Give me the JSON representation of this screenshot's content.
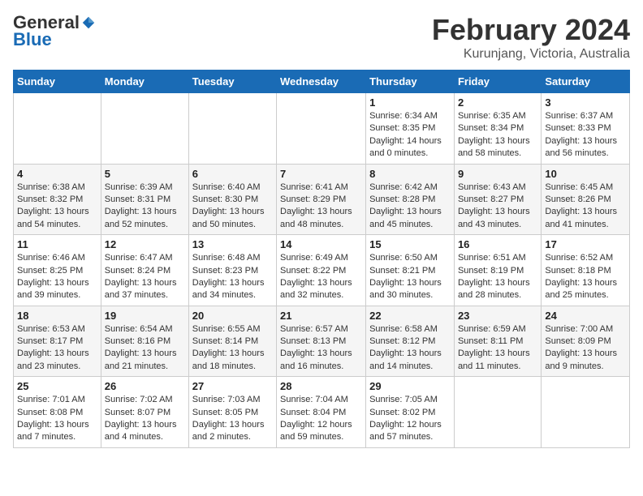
{
  "header": {
    "logo_line1": "General",
    "logo_line2": "Blue",
    "title": "February 2024",
    "subtitle": "Kurunjang, Victoria, Australia"
  },
  "weekdays": [
    "Sunday",
    "Monday",
    "Tuesday",
    "Wednesday",
    "Thursday",
    "Friday",
    "Saturday"
  ],
  "weeks": [
    [
      {
        "num": "",
        "sunrise": "",
        "sunset": "",
        "daylight": ""
      },
      {
        "num": "",
        "sunrise": "",
        "sunset": "",
        "daylight": ""
      },
      {
        "num": "",
        "sunrise": "",
        "sunset": "",
        "daylight": ""
      },
      {
        "num": "",
        "sunrise": "",
        "sunset": "",
        "daylight": ""
      },
      {
        "num": "1",
        "sunrise": "Sunrise: 6:34 AM",
        "sunset": "Sunset: 8:35 PM",
        "daylight": "Daylight: 14 hours and 0 minutes."
      },
      {
        "num": "2",
        "sunrise": "Sunrise: 6:35 AM",
        "sunset": "Sunset: 8:34 PM",
        "daylight": "Daylight: 13 hours and 58 minutes."
      },
      {
        "num": "3",
        "sunrise": "Sunrise: 6:37 AM",
        "sunset": "Sunset: 8:33 PM",
        "daylight": "Daylight: 13 hours and 56 minutes."
      }
    ],
    [
      {
        "num": "4",
        "sunrise": "Sunrise: 6:38 AM",
        "sunset": "Sunset: 8:32 PM",
        "daylight": "Daylight: 13 hours and 54 minutes."
      },
      {
        "num": "5",
        "sunrise": "Sunrise: 6:39 AM",
        "sunset": "Sunset: 8:31 PM",
        "daylight": "Daylight: 13 hours and 52 minutes."
      },
      {
        "num": "6",
        "sunrise": "Sunrise: 6:40 AM",
        "sunset": "Sunset: 8:30 PM",
        "daylight": "Daylight: 13 hours and 50 minutes."
      },
      {
        "num": "7",
        "sunrise": "Sunrise: 6:41 AM",
        "sunset": "Sunset: 8:29 PM",
        "daylight": "Daylight: 13 hours and 48 minutes."
      },
      {
        "num": "8",
        "sunrise": "Sunrise: 6:42 AM",
        "sunset": "Sunset: 8:28 PM",
        "daylight": "Daylight: 13 hours and 45 minutes."
      },
      {
        "num": "9",
        "sunrise": "Sunrise: 6:43 AM",
        "sunset": "Sunset: 8:27 PM",
        "daylight": "Daylight: 13 hours and 43 minutes."
      },
      {
        "num": "10",
        "sunrise": "Sunrise: 6:45 AM",
        "sunset": "Sunset: 8:26 PM",
        "daylight": "Daylight: 13 hours and 41 minutes."
      }
    ],
    [
      {
        "num": "11",
        "sunrise": "Sunrise: 6:46 AM",
        "sunset": "Sunset: 8:25 PM",
        "daylight": "Daylight: 13 hours and 39 minutes."
      },
      {
        "num": "12",
        "sunrise": "Sunrise: 6:47 AM",
        "sunset": "Sunset: 8:24 PM",
        "daylight": "Daylight: 13 hours and 37 minutes."
      },
      {
        "num": "13",
        "sunrise": "Sunrise: 6:48 AM",
        "sunset": "Sunset: 8:23 PM",
        "daylight": "Daylight: 13 hours and 34 minutes."
      },
      {
        "num": "14",
        "sunrise": "Sunrise: 6:49 AM",
        "sunset": "Sunset: 8:22 PM",
        "daylight": "Daylight: 13 hours and 32 minutes."
      },
      {
        "num": "15",
        "sunrise": "Sunrise: 6:50 AM",
        "sunset": "Sunset: 8:21 PM",
        "daylight": "Daylight: 13 hours and 30 minutes."
      },
      {
        "num": "16",
        "sunrise": "Sunrise: 6:51 AM",
        "sunset": "Sunset: 8:19 PM",
        "daylight": "Daylight: 13 hours and 28 minutes."
      },
      {
        "num": "17",
        "sunrise": "Sunrise: 6:52 AM",
        "sunset": "Sunset: 8:18 PM",
        "daylight": "Daylight: 13 hours and 25 minutes."
      }
    ],
    [
      {
        "num": "18",
        "sunrise": "Sunrise: 6:53 AM",
        "sunset": "Sunset: 8:17 PM",
        "daylight": "Daylight: 13 hours and 23 minutes."
      },
      {
        "num": "19",
        "sunrise": "Sunrise: 6:54 AM",
        "sunset": "Sunset: 8:16 PM",
        "daylight": "Daylight: 13 hours and 21 minutes."
      },
      {
        "num": "20",
        "sunrise": "Sunrise: 6:55 AM",
        "sunset": "Sunset: 8:14 PM",
        "daylight": "Daylight: 13 hours and 18 minutes."
      },
      {
        "num": "21",
        "sunrise": "Sunrise: 6:57 AM",
        "sunset": "Sunset: 8:13 PM",
        "daylight": "Daylight: 13 hours and 16 minutes."
      },
      {
        "num": "22",
        "sunrise": "Sunrise: 6:58 AM",
        "sunset": "Sunset: 8:12 PM",
        "daylight": "Daylight: 13 hours and 14 minutes."
      },
      {
        "num": "23",
        "sunrise": "Sunrise: 6:59 AM",
        "sunset": "Sunset: 8:11 PM",
        "daylight": "Daylight: 13 hours and 11 minutes."
      },
      {
        "num": "24",
        "sunrise": "Sunrise: 7:00 AM",
        "sunset": "Sunset: 8:09 PM",
        "daylight": "Daylight: 13 hours and 9 minutes."
      }
    ],
    [
      {
        "num": "25",
        "sunrise": "Sunrise: 7:01 AM",
        "sunset": "Sunset: 8:08 PM",
        "daylight": "Daylight: 13 hours and 7 minutes."
      },
      {
        "num": "26",
        "sunrise": "Sunrise: 7:02 AM",
        "sunset": "Sunset: 8:07 PM",
        "daylight": "Daylight: 13 hours and 4 minutes."
      },
      {
        "num": "27",
        "sunrise": "Sunrise: 7:03 AM",
        "sunset": "Sunset: 8:05 PM",
        "daylight": "Daylight: 13 hours and 2 minutes."
      },
      {
        "num": "28",
        "sunrise": "Sunrise: 7:04 AM",
        "sunset": "Sunset: 8:04 PM",
        "daylight": "Daylight: 12 hours and 59 minutes."
      },
      {
        "num": "29",
        "sunrise": "Sunrise: 7:05 AM",
        "sunset": "Sunset: 8:02 PM",
        "daylight": "Daylight: 12 hours and 57 minutes."
      },
      {
        "num": "",
        "sunrise": "",
        "sunset": "",
        "daylight": ""
      },
      {
        "num": "",
        "sunrise": "",
        "sunset": "",
        "daylight": ""
      }
    ]
  ]
}
